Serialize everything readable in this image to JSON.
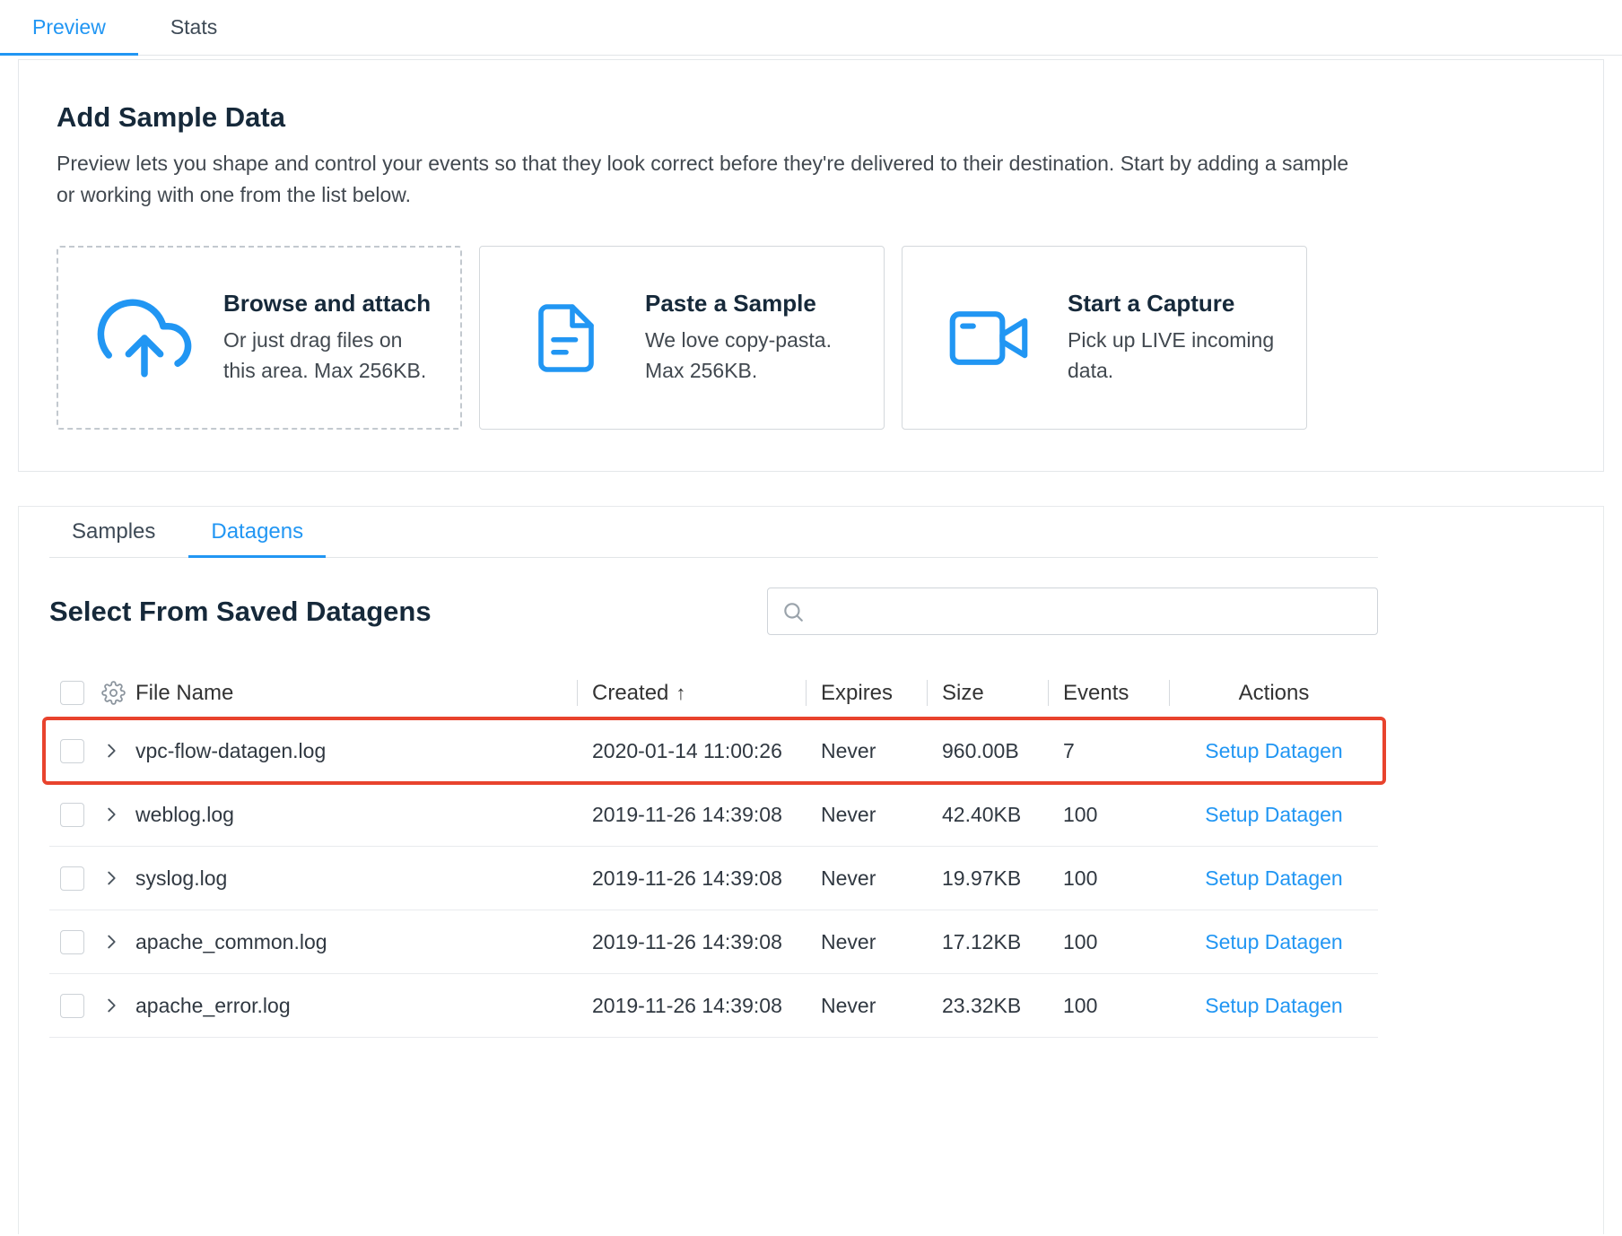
{
  "top_tabs": [
    {
      "label": "Preview",
      "active": true
    },
    {
      "label": "Stats",
      "active": false
    }
  ],
  "sample_section": {
    "title": "Add Sample Data",
    "description": "Preview lets you shape and control your events so that they look correct before they're delivered to their destination. Start by adding a sample or working with one from the list below.",
    "cards": [
      {
        "icon": "cloud-upload-icon",
        "title": "Browse and attach",
        "description": "Or just drag files on this area. Max 256KB."
      },
      {
        "icon": "document-icon",
        "title": "Paste a Sample",
        "description": "We love copy-pasta. Max 256KB."
      },
      {
        "icon": "video-camera-icon",
        "title": "Start a Capture",
        "description": "Pick up LIVE incoming data."
      }
    ]
  },
  "datagen_section": {
    "tabs": [
      {
        "label": "Samples",
        "active": false
      },
      {
        "label": "Datagens",
        "active": true
      }
    ],
    "title": "Select From Saved Datagens",
    "search_value": "",
    "table": {
      "headers": {
        "file_name": "File Name",
        "created": "Created",
        "created_sort": "↑",
        "expires": "Expires",
        "size": "Size",
        "events": "Events",
        "actions": "Actions"
      },
      "rows": [
        {
          "file_name": "vpc-flow-datagen.log",
          "created": "2020-01-14 11:00:26",
          "expires": "Never",
          "size": "960.00B",
          "events": "7",
          "action": "Setup Datagen",
          "highlighted": true
        },
        {
          "file_name": "weblog.log",
          "created": "2019-11-26 14:39:08",
          "expires": "Never",
          "size": "42.40KB",
          "events": "100",
          "action": "Setup Datagen",
          "highlighted": false
        },
        {
          "file_name": "syslog.log",
          "created": "2019-11-26 14:39:08",
          "expires": "Never",
          "size": "19.97KB",
          "events": "100",
          "action": "Setup Datagen",
          "highlighted": false
        },
        {
          "file_name": "apache_common.log",
          "created": "2019-11-26 14:39:08",
          "expires": "Never",
          "size": "17.12KB",
          "events": "100",
          "action": "Setup Datagen",
          "highlighted": false
        },
        {
          "file_name": "apache_error.log",
          "created": "2019-11-26 14:39:08",
          "expires": "Never",
          "size": "23.32KB",
          "events": "100",
          "action": "Setup Datagen",
          "highlighted": false
        }
      ]
    }
  },
  "colors": {
    "accent_blue": "#2196f3",
    "highlight_red": "#e8432d",
    "heading": "#16293a"
  }
}
